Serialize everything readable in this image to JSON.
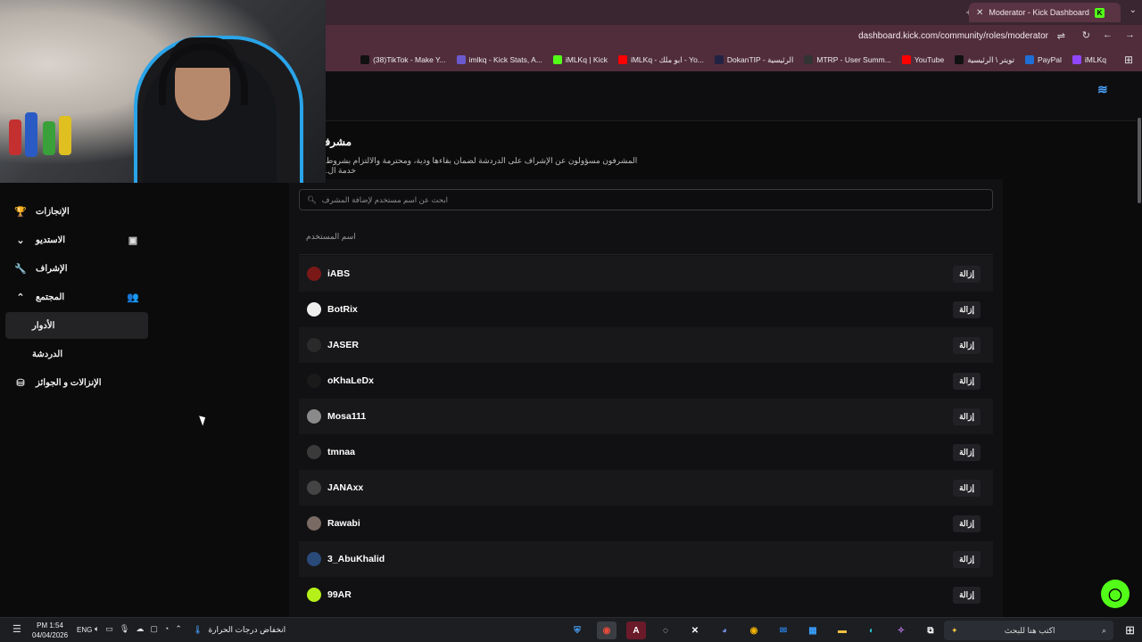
{
  "browser": {
    "active_tab": "Moderator - Kick Dashboard",
    "url": "dashboard.kick.com/community/roles/moderator",
    "bookmarks": [
      {
        "label": "iMLKq",
        "color": "#9146ff"
      },
      {
        "label": "PayPal",
        "color": "#1f6fd6"
      },
      {
        "label": "تويتر \\ الرئيسية",
        "color": "#111111"
      },
      {
        "label": "YouTube",
        "color": "#ff0000"
      },
      {
        "label": "MTRP - User Summ...",
        "color": "#333333"
      },
      {
        "label": "DokanTIP - الرئيسية",
        "color": "#222244"
      },
      {
        "label": "iMLKq - ابو ملك - Yo...",
        "color": "#ff0000"
      },
      {
        "label": "iMLKq | Kick",
        "color": "#53fc18"
      },
      {
        "label": "imlkq - Kick Stats, A...",
        "color": "#6a5acd"
      },
      {
        "label": "(38)TikTok - Make Y...",
        "color": "#111111"
      }
    ]
  },
  "page": {
    "heading": "مشرفي",
    "subtext": "المشرفون مسؤولون عن الإشراف على الدردشة لضمان بقاءها ودية، ومحترمة والالتزام بشروط خدمة ال."
  },
  "sidebar": {
    "items": [
      {
        "label": "الإنجازات",
        "icon": "trophy-icon",
        "glyph": "🏆"
      },
      {
        "label": "الاستديو",
        "icon": "studio-icon",
        "glyph": "⌄",
        "extra": "▣"
      },
      {
        "label": "الإشراف",
        "icon": "wrench-icon",
        "glyph": "🔧"
      },
      {
        "label": "المجتمع",
        "icon": "community-icon",
        "glyph": "⌃",
        "extra": "👥"
      },
      {
        "label": "الأدوار",
        "active": true
      },
      {
        "label": "الدردشة"
      },
      {
        "label": "الإنزالات و الجوائز",
        "icon": "gift-icon",
        "glyph": "⛁"
      }
    ]
  },
  "moderators": {
    "search_placeholder": "ابحث عن اسم مستخدم لإضافة المشرف",
    "column_header": "اسم المستخدم",
    "remove_label": "إزالة",
    "list": [
      {
        "name": "iABS",
        "avatar_color": "#7a1818"
      },
      {
        "name": "BotRix",
        "avatar_color": "#eeeeee"
      },
      {
        "name": "JASER",
        "avatar_color": "#2a2a2a"
      },
      {
        "name": "oKhaLeDx",
        "avatar_color": "#1a1a1a"
      },
      {
        "name": "Mosa111",
        "avatar_color": "#8a8a8a"
      },
      {
        "name": "tmnaa",
        "avatar_color": "#3a3a3a"
      },
      {
        "name": "JANAxx",
        "avatar_color": "#444444"
      },
      {
        "name": "Rawabi",
        "avatar_color": "#7a6a64"
      },
      {
        "name": "3_AbuKhalid",
        "avatar_color": "#2a4a7a"
      },
      {
        "name": "99AR",
        "avatar_color": "#b6f01a"
      }
    ]
  },
  "taskbar": {
    "time": "PM 1:54",
    "date": "04/04/2026",
    "lang": "ENG",
    "weather": "انخفاض درجات الحرارة",
    "search_placeholder": "اكتب هنا للبحث"
  }
}
